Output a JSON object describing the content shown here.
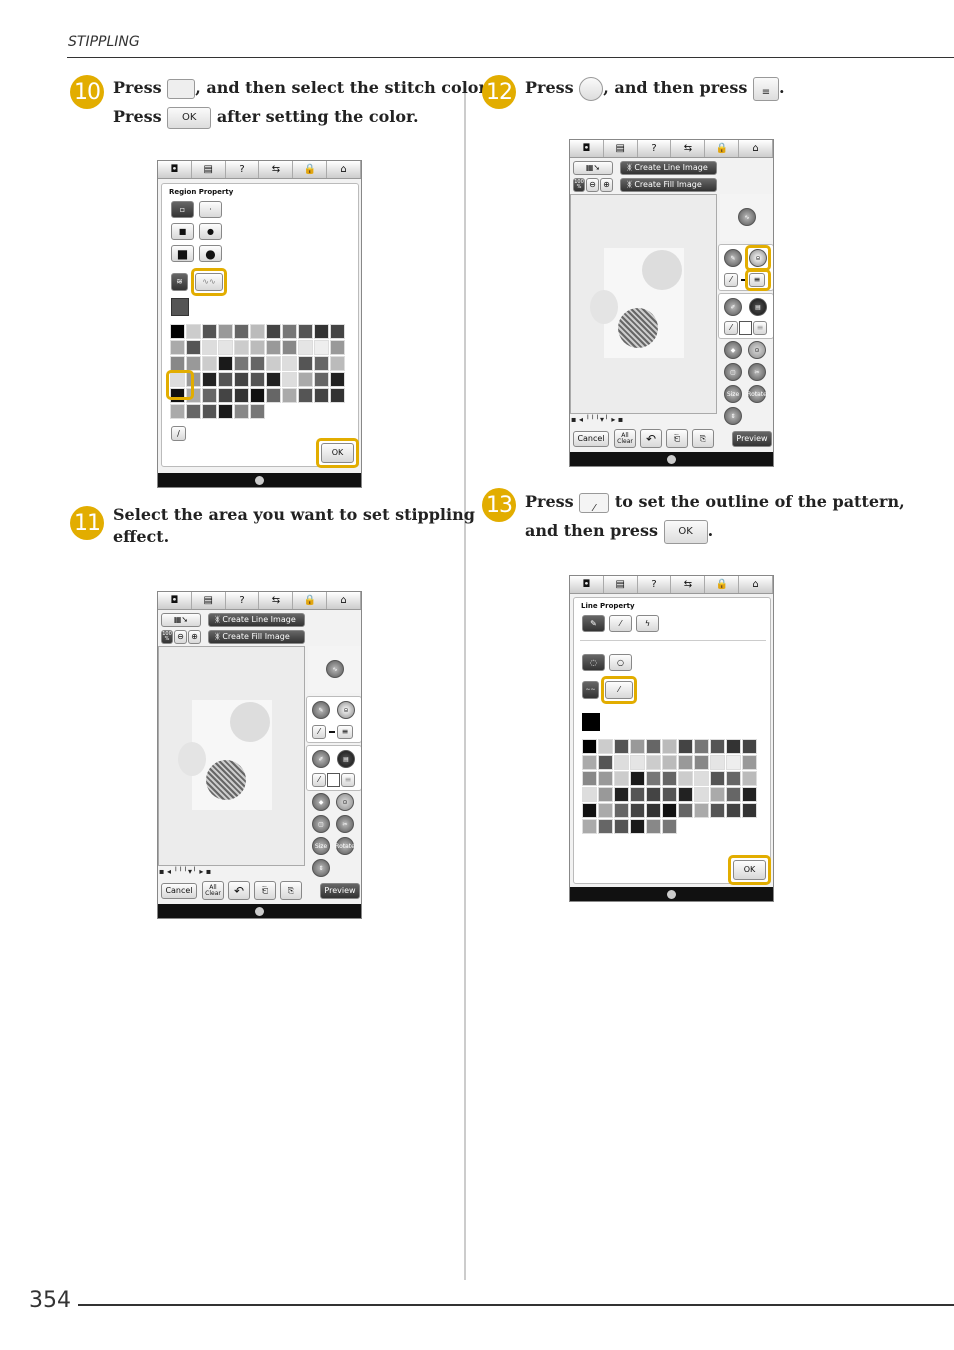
{
  "header": {
    "section": "STIPPLING"
  },
  "page_number": "354",
  "accent_color": "#e2ad00",
  "steps": [
    {
      "number": "10",
      "line1_a": "Press",
      "line1_b": ", and then select the stitch color.",
      "line2_a": "Press",
      "line2_b": "after setting the color.",
      "ok": "OK"
    },
    {
      "number": "11",
      "line1": "Select the area you want to set stippling",
      "line2": "effect."
    },
    {
      "number": "12",
      "line1_a": "Press",
      "line1_b": ", and then press",
      "line1_c": "."
    },
    {
      "number": "13",
      "line1_a": "Press",
      "line1_b": "to set the outline of the pattern,",
      "line2_a": "and then press",
      "line2_b": ".",
      "ok": "OK"
    }
  ],
  "toolbar_icons": [
    "camera-icon",
    "memory-icon",
    "help-icon",
    "flip-icon",
    "lock-icon",
    "home-icon"
  ],
  "toolbar_glyphs": [
    "◘",
    "▤",
    "?",
    "⇆",
    "🔒",
    "⌂"
  ],
  "region_property": {
    "title": "Region Property",
    "ok": "OK"
  },
  "line_property": {
    "title": "Line Property",
    "ok": "OK"
  },
  "design_screen": {
    "create_line": "Create Line Image",
    "create_fill": "Create Fill Image",
    "zoom": "100 %",
    "cancel": "Cancel",
    "all_clear": "All Clear",
    "preview": "Preview",
    "size": "Size",
    "rotate": "Rotate"
  },
  "palette": [
    "#000",
    "#ccc",
    "#555",
    "#999",
    "#666",
    "#bbb",
    "#444",
    "#777",
    "#555",
    "#333",
    "#444",
    "#aaa",
    "#555",
    "#ddd",
    "#e5e5e5",
    "#ccc",
    "#bbb",
    "#999",
    "#888",
    "#e5e5e5",
    "#eee",
    "#999",
    "#888",
    "#999",
    "#ccc",
    "#1a1a1a",
    "#777",
    "#666",
    "#ccc",
    "#ddd",
    "#555",
    "#666",
    "#bbb",
    "#ddd",
    "#999",
    "#222",
    "#555",
    "#444",
    "#555",
    "#222",
    "#ddd",
    "#aaa",
    "#666",
    "#222",
    "#111",
    "#aaa",
    "#666",
    "#444",
    "#333",
    "#111",
    "#666",
    "#aaa",
    "#555",
    "#444",
    "#333",
    "#aaa",
    "#666",
    "#555",
    "#1a1a1a",
    "#888",
    "#777"
  ]
}
